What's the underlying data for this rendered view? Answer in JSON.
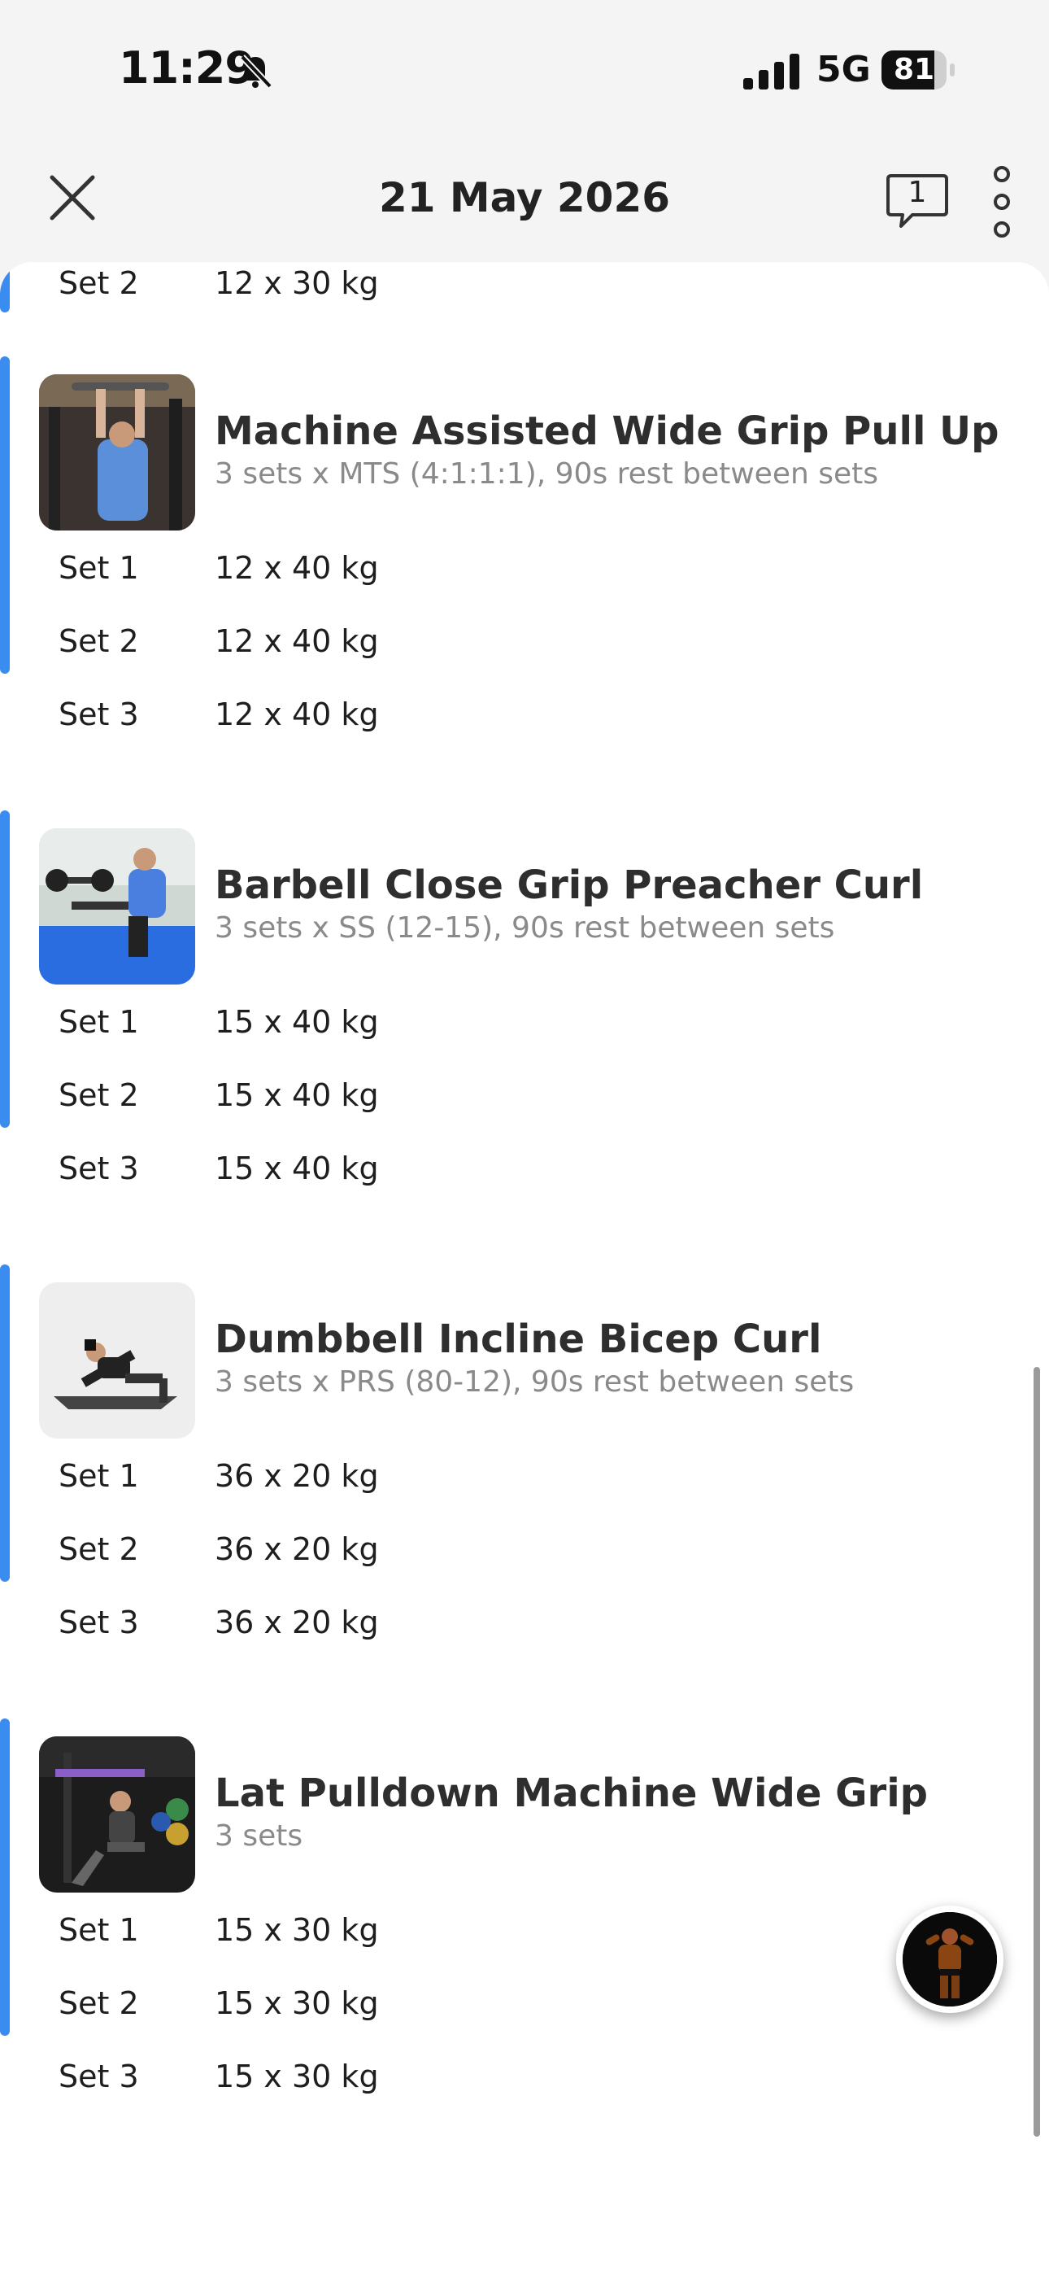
{
  "status_bar": {
    "time": "11:29",
    "network": "5G",
    "battery": "81",
    "battery_level": 0.81
  },
  "nav": {
    "title": "21 May 2026",
    "comment_count": "1"
  },
  "partial_set": {
    "label": "Set 2",
    "value": "12 x 30 kg"
  },
  "exercises": [
    {
      "name": "Machine Assisted Wide Grip Pull Up",
      "desc": "3 sets x MTS (4:1:1:1), 90s rest between sets",
      "sets": [
        {
          "label": "Set 1",
          "value": "12 x 40 kg"
        },
        {
          "label": "Set 2",
          "value": "12 x 40 kg"
        },
        {
          "label": "Set 3",
          "value": "12 x 40 kg"
        }
      ]
    },
    {
      "name": "Barbell Close Grip Preacher Curl",
      "desc": "3 sets x SS (12-15), 90s rest between sets",
      "sets": [
        {
          "label": "Set 1",
          "value": "15 x 40 kg"
        },
        {
          "label": "Set 2",
          "value": "15 x 40 kg"
        },
        {
          "label": "Set 3",
          "value": "15 x 40 kg"
        }
      ]
    },
    {
      "name": "Dumbbell Incline Bicep Curl",
      "desc": "3 sets x PRS (80-12), 90s rest between sets",
      "sets": [
        {
          "label": "Set 1",
          "value": "36 x 20 kg"
        },
        {
          "label": "Set 2",
          "value": "36 x 20 kg"
        },
        {
          "label": "Set 3",
          "value": "36 x 20 kg"
        }
      ]
    },
    {
      "name": "Lat Pulldown Machine Wide Grip",
      "desc": "3 sets",
      "sets": [
        {
          "label": "Set 1",
          "value": "15 x 30 kg"
        },
        {
          "label": "Set 2",
          "value": "15 x 30 kg"
        },
        {
          "label": "Set 3",
          "value": "15 x 30 kg"
        }
      ]
    }
  ],
  "colors": {
    "accent": "#3b8cf0",
    "background": "#f4f4f5",
    "text": "#2e2e2e",
    "muted": "#8a8a8a"
  }
}
